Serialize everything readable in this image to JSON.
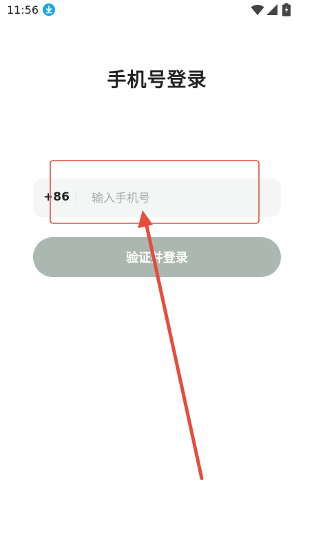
{
  "status_bar": {
    "time": "11:56",
    "icons": [
      "download-icon",
      "wifi-icon",
      "signal-icon",
      "battery-icon"
    ],
    "download_color": "#1aa6e8"
  },
  "page": {
    "title": "手机号登录"
  },
  "phone_input": {
    "country_code": "+86",
    "value": "",
    "placeholder": "输入手机号"
  },
  "login_button": {
    "label": "验证并登录",
    "color": "#aab8b1"
  },
  "annotation": {
    "color": "#e74c3c",
    "icons": [
      "highlight-rectangle",
      "arrow-pointer"
    ]
  }
}
